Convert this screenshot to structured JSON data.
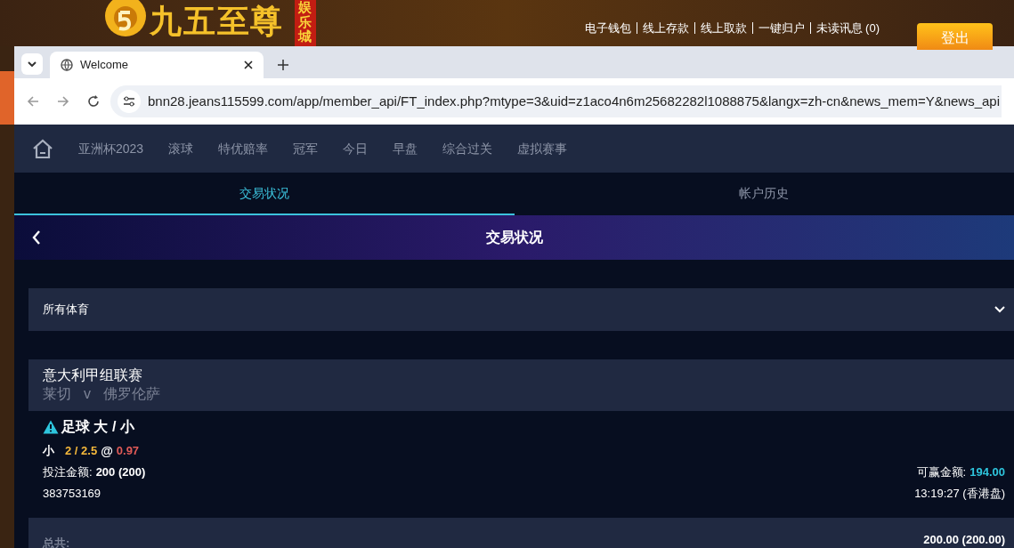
{
  "site_header": {
    "logo_text": "九五至尊",
    "logo_badge": "娱乐城",
    "links": [
      "电子钱包",
      "线上存款",
      "线上取款",
      "一键归户",
      "未读讯息 (0)"
    ],
    "logout_button": "登出"
  },
  "browser": {
    "tab_title": "Welcome",
    "url": "bnn28.jeans115599.com/app/member_api/FT_index.php?mtype=3&uid=z1aco4n6m25682282l1088875&langx=zh-cn&news_mem=Y&news_api"
  },
  "nav": {
    "items": [
      "亚洲杯2023",
      "滚球",
      "特优赔率",
      "冠军",
      "今日",
      "早盘",
      "综合过关",
      "虚拟赛事"
    ]
  },
  "tabs": [
    {
      "label": "交易状况",
      "selected": true
    },
    {
      "label": "帐户历史",
      "selected": false
    }
  ],
  "page_header": {
    "title": "交易状况"
  },
  "filter": {
    "label": "所有体育"
  },
  "bet": {
    "league": "意大利甲组联赛",
    "home_team": "莱切",
    "vs": "v",
    "away_team": "佛罗伦萨",
    "market": "足球 大 / 小",
    "selection": "小",
    "line": "2 / 2.5",
    "at": "@",
    "odds": "0.97",
    "stake_label": "投注金额:",
    "stake_value": "200 (200)",
    "win_label": "可赢金额:",
    "win_value": "194.00",
    "ticket_id": "383753169",
    "time": "13:19:27 (香港盘)"
  },
  "total": {
    "label": "总共:",
    "value": "200.00 (200.00)"
  }
}
